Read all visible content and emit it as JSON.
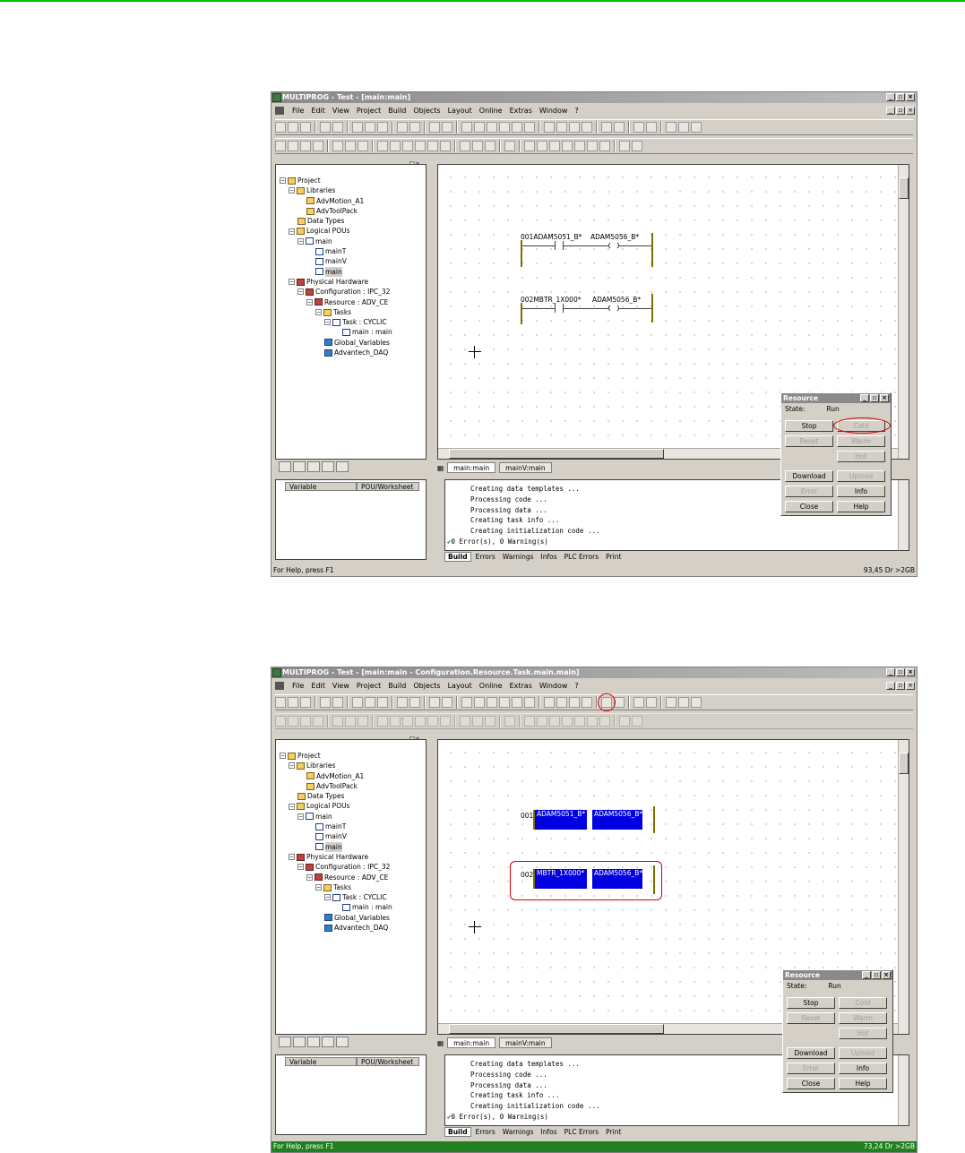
{
  "colors": {
    "selection": "#0000e0",
    "annotation": "#d00000",
    "status_bar_2": "#208020",
    "top_line": "#00c000"
  },
  "menu": [
    "File",
    "Edit",
    "View",
    "Project",
    "Build",
    "Objects",
    "Layout",
    "Online",
    "Extras",
    "Window",
    "?"
  ],
  "tree": [
    {
      "label": "Project",
      "level": 0,
      "icon": "folder-icon"
    },
    {
      "label": "Libraries",
      "level": 1,
      "icon": "folder-icon"
    },
    {
      "label": "AdvMotion_A1",
      "level": 2,
      "icon": "library-icon"
    },
    {
      "label": "AdvToolPack",
      "level": 2,
      "icon": "library-icon"
    },
    {
      "label": "Data Types",
      "level": 1,
      "icon": "folder-icon"
    },
    {
      "label": "Logical POUs",
      "level": 1,
      "icon": "folder-icon"
    },
    {
      "label": "main",
      "level": 2,
      "icon": "pou-icon"
    },
    {
      "label": "mainT",
      "level": 3,
      "icon": "pou-icon"
    },
    {
      "label": "mainV",
      "level": 3,
      "icon": "pou-icon"
    },
    {
      "label": "main",
      "level": 3,
      "icon": "pou-icon"
    },
    {
      "label": "Physical Hardware",
      "level": 1,
      "icon": "hardware-icon"
    },
    {
      "label": "Configuration : IPC_32",
      "level": 2,
      "icon": "hardware-icon"
    },
    {
      "label": "Resource : ADV_CE",
      "level": 3,
      "icon": "hardware-icon"
    },
    {
      "label": "Tasks",
      "level": 4,
      "icon": "folder-icon"
    },
    {
      "label": "Task : CYCLIC",
      "level": 5,
      "icon": "pou-icon"
    },
    {
      "label": "main : main",
      "level": 6,
      "icon": "pou-icon"
    },
    {
      "label": "Global_Variables",
      "level": 4,
      "icon": "variables-icon"
    },
    {
      "label": "Advantech_DAQ",
      "level": 4,
      "icon": "variables-icon"
    }
  ],
  "editor_tabs": [
    "main:main",
    "mainV:main"
  ],
  "var_headers": [
    "Variable",
    "POU/Worksheet"
  ],
  "output_lines": [
    "Creating data templates ...",
    "Processing code ...",
    "Processing data ...",
    "Creating task info ...",
    "Creating initialization code ...",
    "0 Error(s), 0 Warning(s)"
  ],
  "output_tabs": [
    "Build",
    "Errors",
    "Warnings",
    "Infos",
    "PLC Errors",
    "Print"
  ],
  "resource": {
    "title": "Resource",
    "state_label": "State:",
    "state_value": "Run",
    "buttons": [
      "Stop",
      "Cold",
      "Reset",
      "Warm",
      "",
      "Hot",
      "Download",
      "Upload",
      "Error",
      "Info",
      "Close",
      "Help"
    ]
  },
  "win1": {
    "title": "MULTIPROG - Test - [main:main]",
    "rung1": {
      "num": "001",
      "contact": "ADAM5051_B*",
      "coil": "ADAM5056_B*"
    },
    "rung2": {
      "num": "002",
      "contact": "MBTR_1X000*",
      "coil": "ADAM5056_B*"
    },
    "status_left": "For Help, press F1",
    "status_right": "93,45  Dr >2GB"
  },
  "win2": {
    "title": "MULTIPROG - Test - [main:main - Configuration.Resource.Task.main.main]",
    "rung1": {
      "num": "001",
      "contact": "ADAM5051_B*",
      "coil": "ADAM5056_B*"
    },
    "rung2": {
      "num": "002",
      "contact": "MBTR_1X000*",
      "coil": "ADAM5056_B*"
    },
    "status_left": "For Help, press F1",
    "status_right": "73,24  Dr >2GB"
  }
}
